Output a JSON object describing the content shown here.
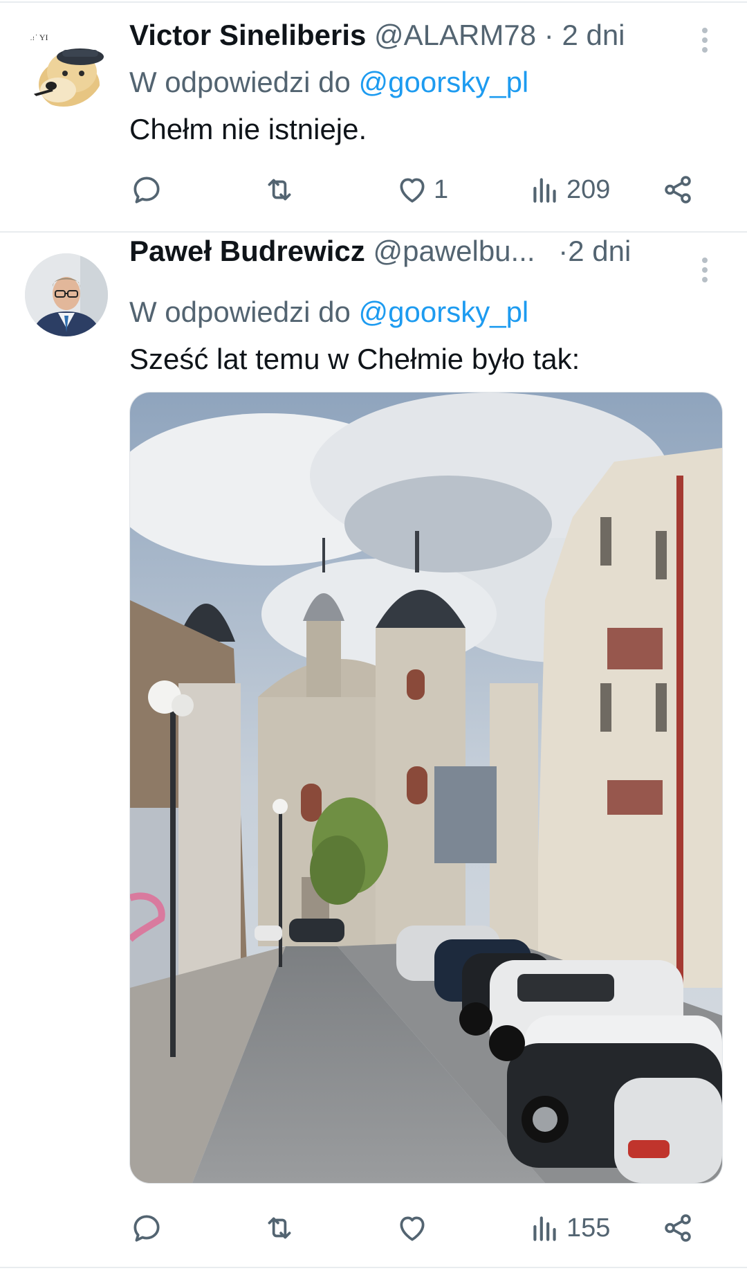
{
  "tweets": [
    {
      "author_name": "Victor Sineliberis",
      "handle": "@ALARM78",
      "separator": "·",
      "time": "2 dni",
      "reply_prefix": "W odpowiedzi do",
      "reply_to": "@goorsky_pl",
      "text": "Chełm nie istnieje.",
      "actions": {
        "reply_icon": "reply-icon",
        "retweet_icon": "retweet-icon",
        "like_icon": "heart-icon",
        "like_count": "1",
        "views_icon": "views-icon",
        "views_count": "209",
        "share_icon": "share-icon"
      }
    },
    {
      "author_name": "Paweł Budrewicz",
      "handle": "@pawelbu...",
      "separator": "·",
      "time": "2 dni",
      "reply_prefix": "W odpowiedzi do",
      "reply_to": "@goorsky_pl",
      "text": "Sześć lat temu w Chełmie było tak:",
      "actions": {
        "reply_icon": "reply-icon",
        "retweet_icon": "retweet-icon",
        "like_icon": "heart-icon",
        "like_count": "",
        "views_icon": "views-icon",
        "views_count": "155",
        "share_icon": "share-icon"
      }
    }
  ],
  "colors": {
    "text": "#0f1419",
    "secondary": "#536471",
    "link": "#1d9bf0",
    "divider": "#e8ecef"
  }
}
